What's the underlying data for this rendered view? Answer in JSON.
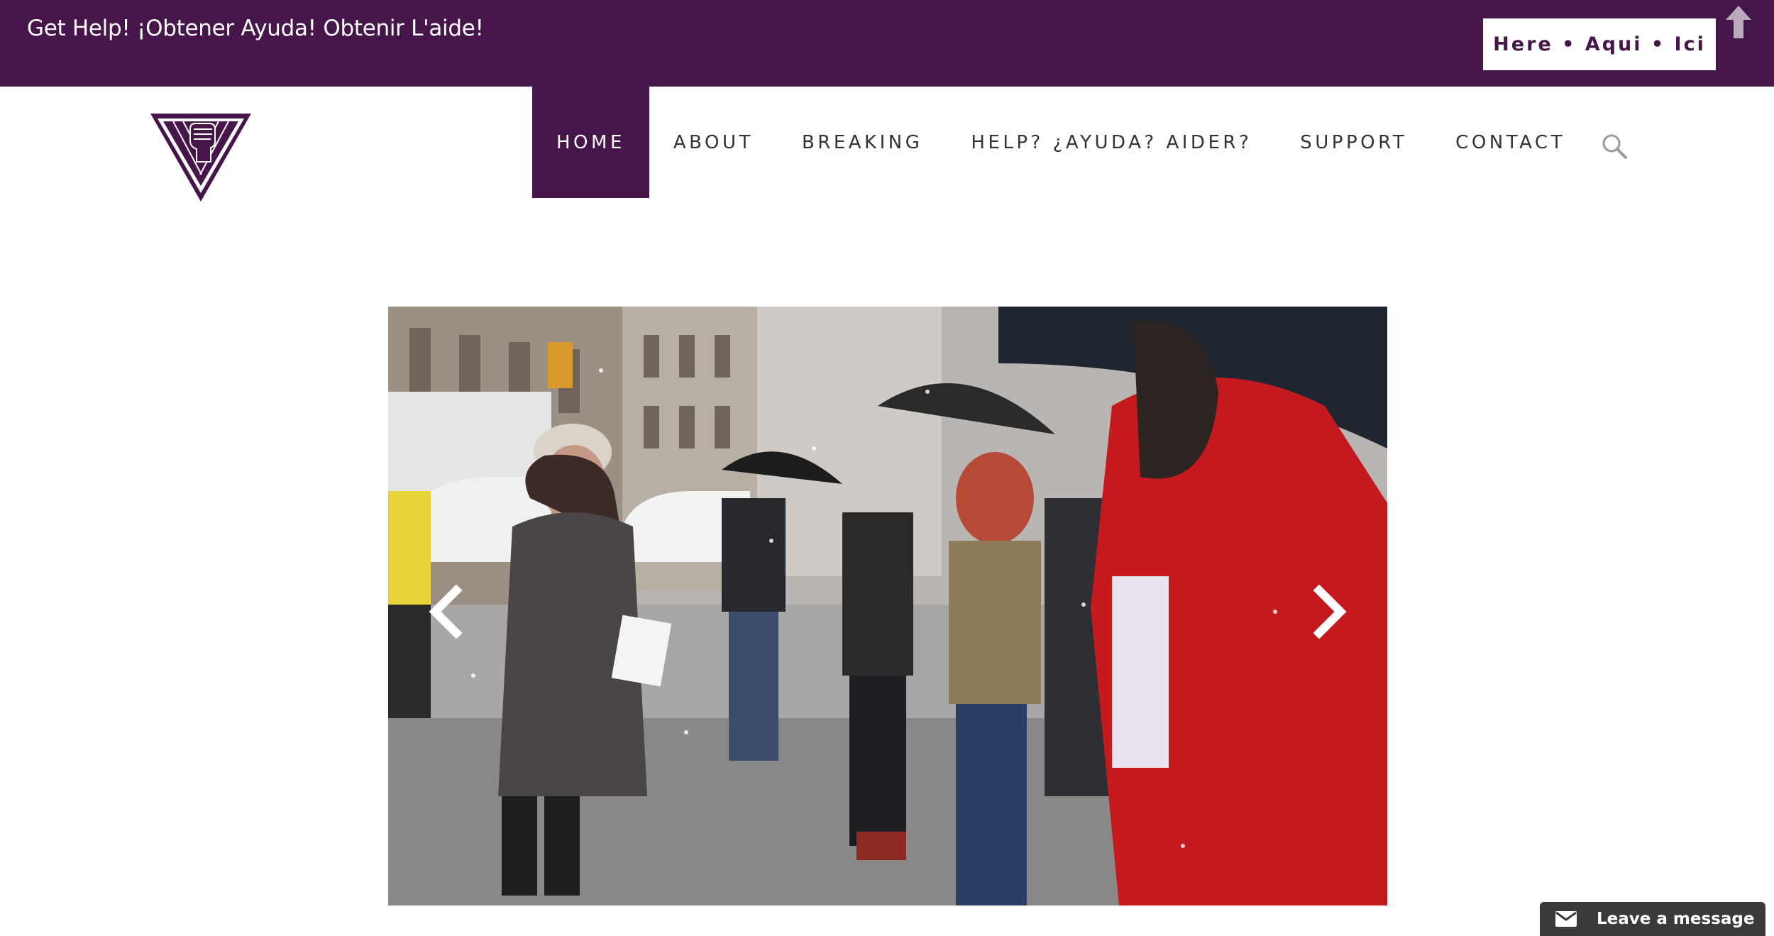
{
  "colors": {
    "brand": "#46164a",
    "nav_text": "#333333",
    "chat_bg": "#3a3a3a"
  },
  "topbar": {
    "help_text": "Get Help! ¡Obtener Ayuda! Obtenir L'aide!",
    "help_button_label": "Here • Aqui • Ici",
    "scroll_top_icon": "arrow-up-icon"
  },
  "header": {
    "logo_icon": "raised-fist-triangle-logo",
    "nav": [
      {
        "label": "HOME",
        "active": true
      },
      {
        "label": "ABOUT",
        "active": false
      },
      {
        "label": "BREAKING",
        "active": false
      },
      {
        "label": "HELP? ¿AYUDA? AIDER?",
        "active": false
      },
      {
        "label": "SUPPORT",
        "active": false
      },
      {
        "label": "CONTACT",
        "active": false
      }
    ],
    "search_icon": "search-icon"
  },
  "slider": {
    "image_alt": "Group of people standing in the snow on a city sidewalk with umbrellas and flyers",
    "prev_icon": "chevron-left-icon",
    "next_icon": "chevron-right-icon"
  },
  "chat_widget": {
    "label": "Leave a message",
    "icon": "mail-icon"
  }
}
